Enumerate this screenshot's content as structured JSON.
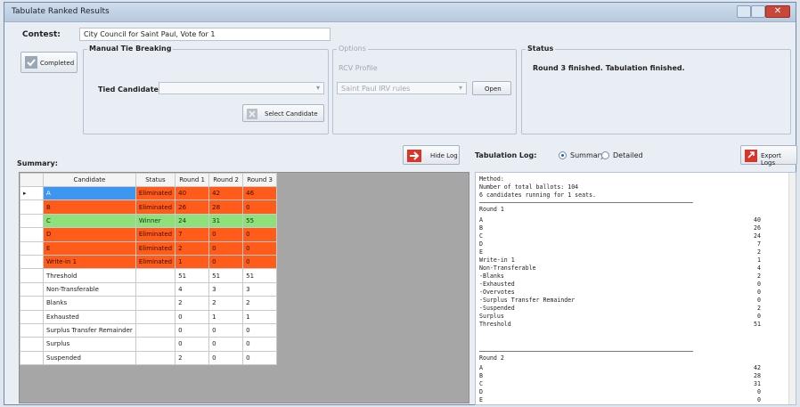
{
  "window": {
    "title": "Tabulate Ranked Results"
  },
  "contest": {
    "label": "Contest:",
    "value": "City Council for Saint Paul, Vote for 1"
  },
  "completed_button": {
    "label": "Completed"
  },
  "manual_tie": {
    "title": "Manual Tie Breaking",
    "tied_label": "Tied Candidates:",
    "select_button": "Select Candidate"
  },
  "options": {
    "title": "Options",
    "rcv_profile_label": "RCV Profile",
    "profile_value": "Saint Paul IRV rules",
    "open_button": "Open"
  },
  "status": {
    "title": "Status",
    "text": "Round 3 finished. Tabulation finished."
  },
  "summary": {
    "label": "Summary:",
    "hide_log_button": "Hide Log",
    "columns": [
      "Candidate",
      "Status",
      "Round 1",
      "Round 2",
      "Round 3"
    ],
    "rows": [
      {
        "candidate": "A",
        "status": "Eliminated",
        "r1": "40",
        "r2": "42",
        "r3": "46"
      },
      {
        "candidate": "B",
        "status": "Eliminated",
        "r1": "26",
        "r2": "28",
        "r3": "0"
      },
      {
        "candidate": "C",
        "status": "Winner",
        "r1": "24",
        "r2": "31",
        "r3": "55"
      },
      {
        "candidate": "D",
        "status": "Eliminated",
        "r1": "7",
        "r2": "0",
        "r3": "0"
      },
      {
        "candidate": "E",
        "status": "Eliminated",
        "r1": "2",
        "r2": "0",
        "r3": "0"
      },
      {
        "candidate": "Write-in 1",
        "status": "Eliminated",
        "r1": "1",
        "r2": "0",
        "r3": "0"
      },
      {
        "candidate": "Threshold",
        "status": "",
        "r1": "51",
        "r2": "51",
        "r3": "51"
      },
      {
        "candidate": "Non-Transferable",
        "status": "",
        "r1": "4",
        "r2": "3",
        "r3": "3"
      },
      {
        "candidate": "Blanks",
        "status": "",
        "r1": "2",
        "r2": "2",
        "r3": "2"
      },
      {
        "candidate": "Exhausted",
        "status": "",
        "r1": "0",
        "r2": "1",
        "r3": "1"
      },
      {
        "candidate": "Surplus Transfer Remainder",
        "status": "",
        "r1": "0",
        "r2": "0",
        "r3": "0"
      },
      {
        "candidate": "Surplus",
        "status": "",
        "r1": "0",
        "r2": "0",
        "r3": "0"
      },
      {
        "candidate": "Suspended",
        "status": "",
        "r1": "2",
        "r2": "0",
        "r3": "0"
      }
    ]
  },
  "log": {
    "label": "Tabulation Log:",
    "summary_option": "Summary",
    "detailed_option": "Detailed",
    "export_button": "Export Logs",
    "lines": [
      {
        "text": "Method:",
        "value": ""
      },
      {
        "text": "Number of total ballots: 104",
        "value": ""
      },
      {
        "text": "6 candidates running for 1 seats.",
        "value": ""
      },
      {
        "text": "Round 1",
        "value": ""
      },
      {
        "text": "A",
        "value": "40"
      },
      {
        "text": "B",
        "value": "26"
      },
      {
        "text": "C",
        "value": "24"
      },
      {
        "text": "D",
        "value": "7"
      },
      {
        "text": "E",
        "value": "2"
      },
      {
        "text": "Write-in 1",
        "value": "1"
      },
      {
        "text": "Non-Transferable",
        "value": "4"
      },
      {
        "text": "-Blanks",
        "value": "2"
      },
      {
        "text": "-Exhausted",
        "value": "0"
      },
      {
        "text": "-Overvotes",
        "value": "0"
      },
      {
        "text": "-Surplus Transfer Remainder",
        "value": "0"
      },
      {
        "text": "-Suspended",
        "value": "2"
      },
      {
        "text": "Surplus",
        "value": "0"
      },
      {
        "text": "Threshold",
        "value": "51"
      },
      {
        "text": "Round 2",
        "value": ""
      },
      {
        "text": "A",
        "value": "42"
      },
      {
        "text": "B",
        "value": "28"
      },
      {
        "text": "C",
        "value": "31"
      },
      {
        "text": "D",
        "value": "0"
      },
      {
        "text": "E",
        "value": "0"
      }
    ]
  }
}
